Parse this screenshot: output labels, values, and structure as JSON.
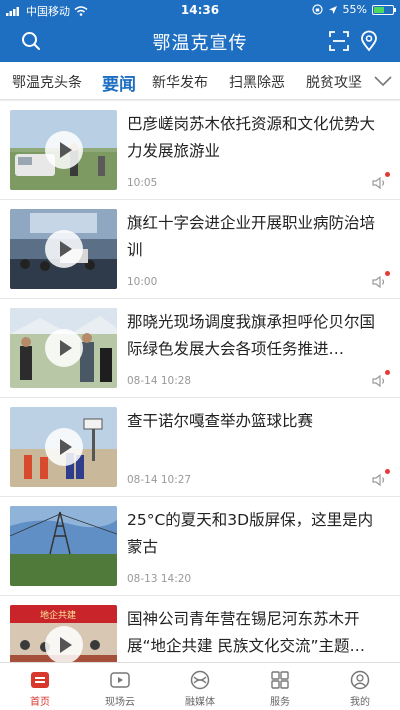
{
  "status": {
    "carrier": "中国移动",
    "time": "14:36",
    "battery": "55%",
    "battery_level": 0.55
  },
  "header": {
    "title": "鄂温克宣传"
  },
  "tabs": [
    "鄂温克头条",
    "要闻",
    "新华发布",
    "扫黑除恶",
    "脱贫攻坚"
  ],
  "active_tab": "要闻",
  "news": [
    {
      "title": "巴彦嵯岗苏木依托资源和文化优势大力发展旅游业",
      "time": "10:05",
      "audio_new": true
    },
    {
      "title": "旗红十字会进企业开展职业病防治培训",
      "time": "10:00",
      "audio_new": true
    },
    {
      "title": "那晓光现场调度我旗承担呼伦贝尔国际绿色发展大会各项任务推进…",
      "time": "08-14 10:28",
      "audio_new": true
    },
    {
      "title": "查干诺尔嘎查举办篮球比赛",
      "time": "08-14 10:27",
      "audio_new": true
    },
    {
      "title": "25°C的夏天和3D版屏保，这里是内蒙古",
      "time": "08-13 14:20",
      "audio_new": false
    },
    {
      "title": "国神公司青年营在锡尼河东苏木开展“地企共建 民族文化交流”主题…",
      "time": "",
      "audio_new": false
    }
  ],
  "thumb_banner_text": "地企共建",
  "bottom_nav": [
    {
      "label": "首页",
      "icon": "home-icon",
      "active": true
    },
    {
      "label": "现场云",
      "icon": "video-play-icon",
      "active": false
    },
    {
      "label": "融媒体",
      "icon": "media-icon",
      "active": false
    },
    {
      "label": "服务",
      "icon": "grid-icon",
      "active": false
    },
    {
      "label": "我的",
      "icon": "user-icon",
      "active": false
    }
  ],
  "colors": {
    "brand": "#1e6fc2",
    "active_nav": "#d8372e"
  }
}
